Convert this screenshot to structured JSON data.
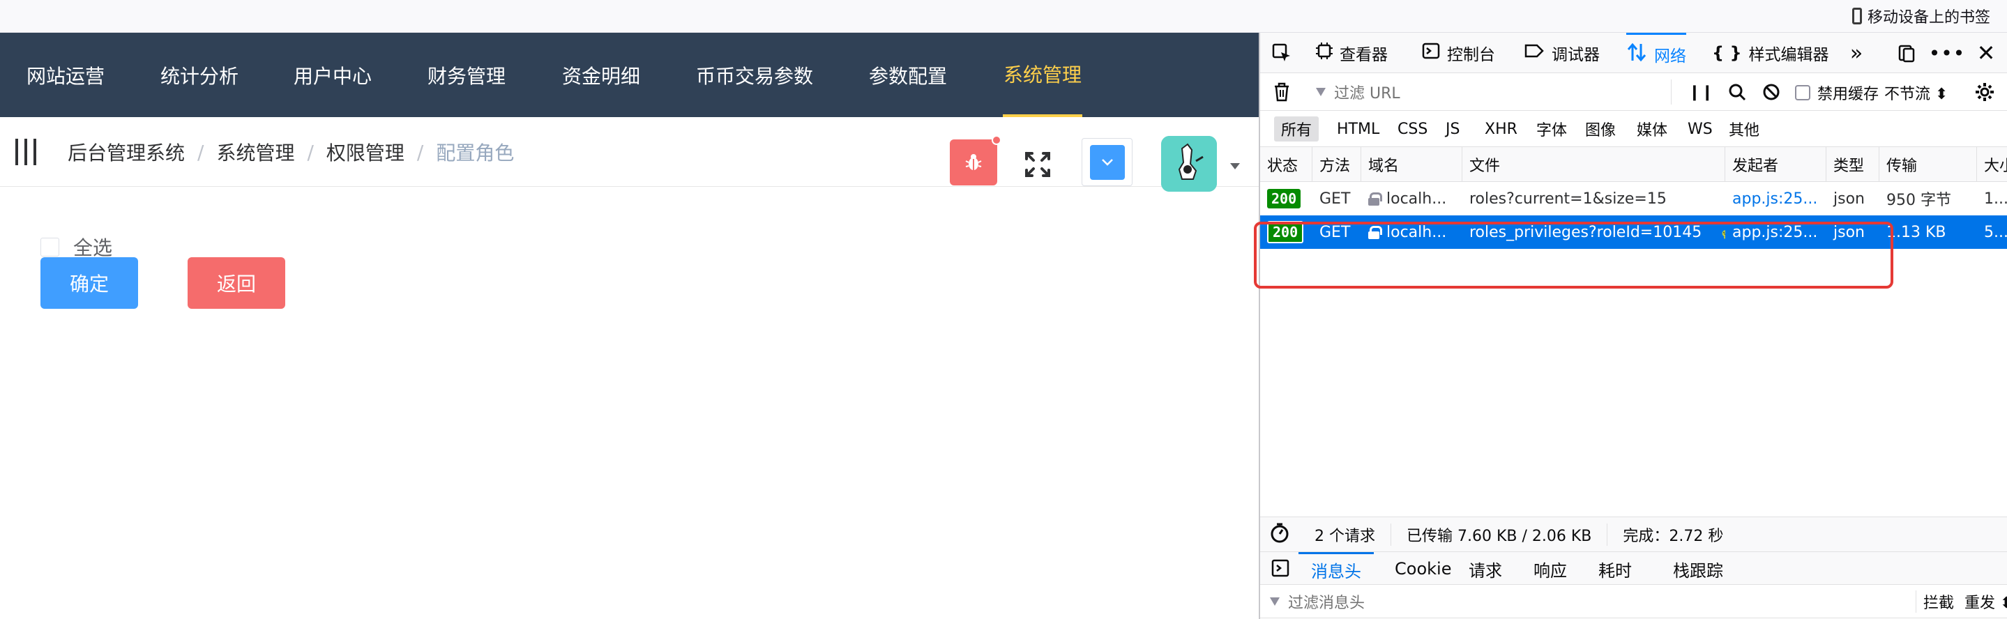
{
  "browser": {
    "mobile_bookmarks": "移动设备上的书签"
  },
  "app": {
    "nav_items": [
      {
        "label": "网站运营"
      },
      {
        "label": "统计分析"
      },
      {
        "label": "用户中心"
      },
      {
        "label": "财务管理"
      },
      {
        "label": "资金明细"
      },
      {
        "label": "币币交易参数"
      },
      {
        "label": "参数配置"
      },
      {
        "label": "系统管理"
      }
    ],
    "active_nav": "系统管理",
    "breadcrumb": [
      "后台管理系统",
      "系统管理",
      "权限管理",
      "配置角色"
    ],
    "breadcrumb_separator": "/",
    "select_all_label": "全选",
    "confirm_label": "确定",
    "back_label": "返回",
    "colors": {
      "nav_bg": "#304156",
      "nav_active": "#ffd04b",
      "primary": "#409eff",
      "danger": "#f56c6c"
    }
  },
  "devtools": {
    "tabs": [
      {
        "label": "查看器",
        "icon": "inspector-icon"
      },
      {
        "label": "控制台",
        "icon": "console-icon"
      },
      {
        "label": "调试器",
        "icon": "debugger-icon"
      },
      {
        "label": "网络",
        "icon": "network-icon"
      },
      {
        "label": "样式编辑器",
        "icon": "style-editor-icon"
      }
    ],
    "active_tab": "网络",
    "filter_placeholder": "过滤 URL",
    "disable_cache_label": "禁用缓存",
    "throttle_label": "不节流 ⬍",
    "types": [
      "所有",
      "HTML",
      "CSS",
      "JS",
      "XHR",
      "字体",
      "图像",
      "媒体",
      "WS",
      "其他"
    ],
    "columns": [
      "状态",
      "方法",
      "域名",
      "文件",
      "发起者",
      "类型",
      "传输",
      "大小"
    ],
    "rows": [
      {
        "status": "200",
        "method": "GET",
        "domain": "localh...",
        "file": "roles?current=1&size=15",
        "initiator": "app.js:25...",
        "type": "json",
        "transfer": "950 字节",
        "size": "1...."
      },
      {
        "status": "200",
        "method": "GET",
        "domain": "localh...",
        "file": "roles_privileges?roleId=10145",
        "initiator": "app.js:25...",
        "type": "json",
        "transfer": "1.13 KB",
        "size": "5..."
      }
    ],
    "summary": {
      "requests": "2 个请求",
      "transferred": "已传输 7.60 KB / 2.06 KB",
      "finish": "完成：2.72 秒"
    },
    "detail_tabs": [
      "消息头",
      "Cookie",
      "请求",
      "响应",
      "耗时",
      "栈跟踪"
    ],
    "detail_filter_placeholder": "过滤消息头",
    "block_label": "拦截",
    "resend_label": "重发 ⬍",
    "colors": {
      "accent": "#0a84ff",
      "selected_row": "#0074e8",
      "status_ok": "#058b00",
      "highlight": "#e53935"
    }
  }
}
